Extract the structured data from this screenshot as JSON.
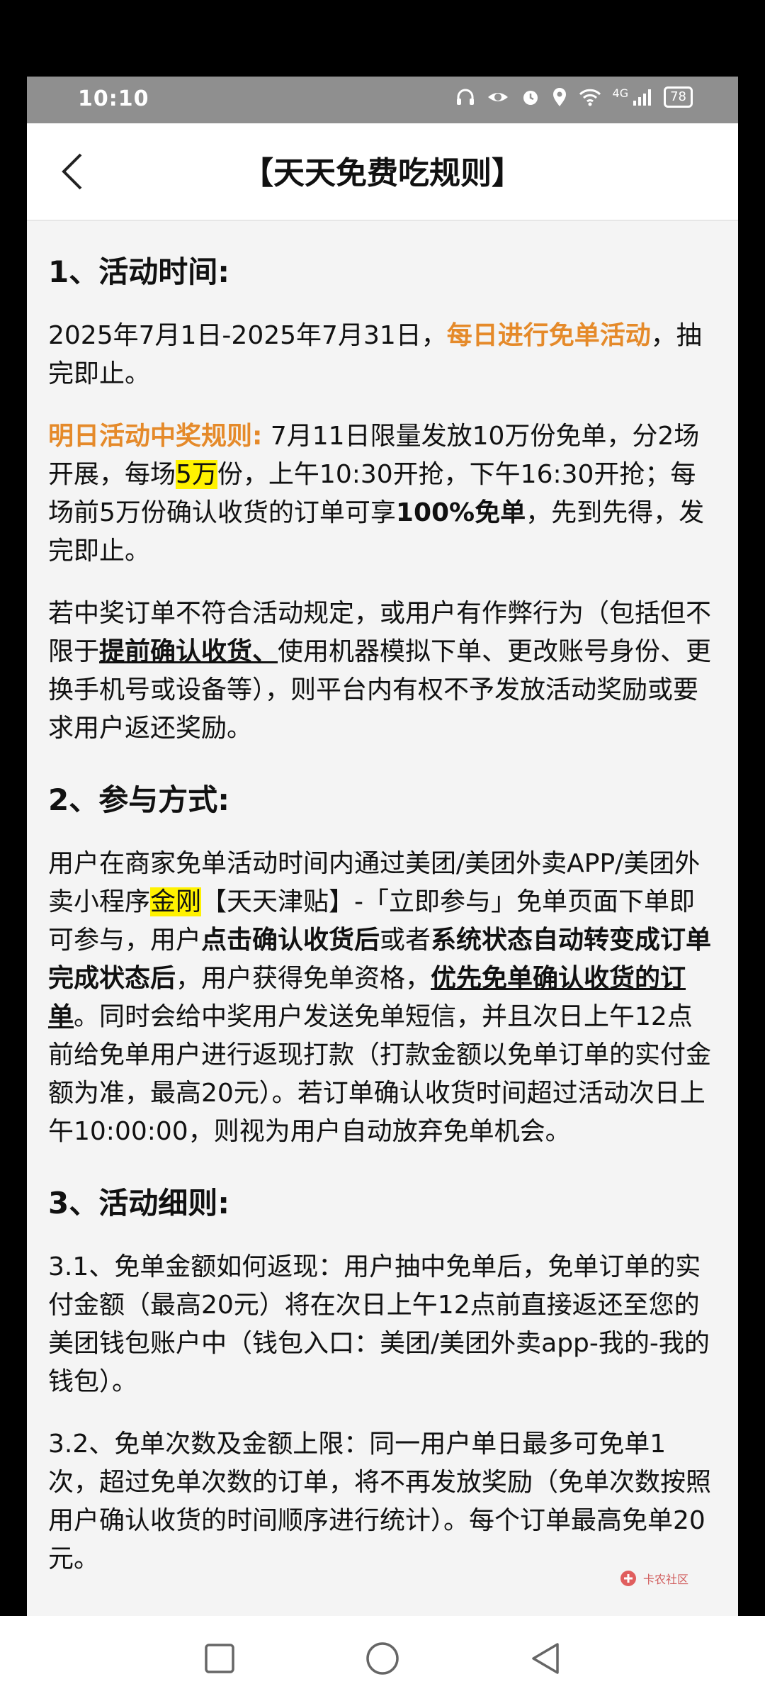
{
  "status_bar": {
    "time": "10:10",
    "icons": [
      "headphones-icon",
      "eye-icon",
      "alarm-icon",
      "location-icon",
      "wifi-icon",
      "signal-icon"
    ],
    "network_label": "4G",
    "battery": "78"
  },
  "header": {
    "title": "【天天免费吃规则】"
  },
  "sections": {
    "s1_title": "1、活动时间:",
    "s1_p1_a": "2025年7月1日-2025年7月31日，",
    "s1_p1_b": "每日进行免单活动",
    "s1_p1_c": "，抽完即止。",
    "s1_p2_a": "明日活动中奖规则:",
    "s1_p2_b": " 7月11日限量发放10万份免单，分2场开展，每场",
    "s1_p2_c": "5万",
    "s1_p2_d": "份，上午10:30开抢，下午16:30开抢；每场前5万份确认收货的订单可享",
    "s1_p2_e": "100%免单",
    "s1_p2_f": "，先到先得，发完即止。",
    "s1_p3_a": "若中奖订单不符合活动规定，或用户有作弊行为（包括但不限于",
    "s1_p3_b": "提前确认收货、",
    "s1_p3_c": "使用机器模拟下单、更改账号身份、更换手机号或设备等），则平台内有权不予发放活动奖励或要求用户返还奖励。",
    "s2_title": "2、参与方式:",
    "s2_p1_a": "用户在商家免单活动时间内通过美团/美团外卖APP/美团外卖小程序",
    "s2_p1_b": "金刚",
    "s2_p1_c": "【天天津贴】-「立即参与」免单页面下单即可参与，用户",
    "s2_p1_d": "点击确认收货后",
    "s2_p1_e": "或者",
    "s2_p1_f": "系统状态自动转变成订单完成状态后",
    "s2_p1_g": "，用户获得免单资格，",
    "s2_p1_h": "优先免单确认收货的订单",
    "s2_p1_i": "。同时会给中奖用户发送免单短信，并且次日上午12点前给免单用户进行返现打款（打款金额以免单订单的实付金额为准，最高20元）。若订单确认收货时间超过活动次日上午10:00:00，则视为用户自动放弃免单机会。",
    "s3_title": "3、活动细则:",
    "s3_p1": "3.1、免单金额如何返现：用户抽中免单后，免单订单的实付金额（最高20元）将在次日上午12点前直接返还至您的美团钱包账户中（钱包入口：美团/美团外卖app-我的-我的钱包）。",
    "s3_p2": "3.2、免单次数及金额上限：同一用户单日最多可免单1次，超过免单次数的订单，将不再发放奖励（免单次数按照用户确认收货的时间顺序进行统计）。每个订单最高免单20元。"
  },
  "watermark": {
    "text": "卡农社区"
  },
  "nav": {
    "recents": "recents-square-icon",
    "home": "home-circle-icon",
    "back": "back-triangle-icon"
  },
  "colors": {
    "accent_orange": "#e58a2a",
    "highlight": "#fff200",
    "status_bg": "#8f8f8f"
  }
}
